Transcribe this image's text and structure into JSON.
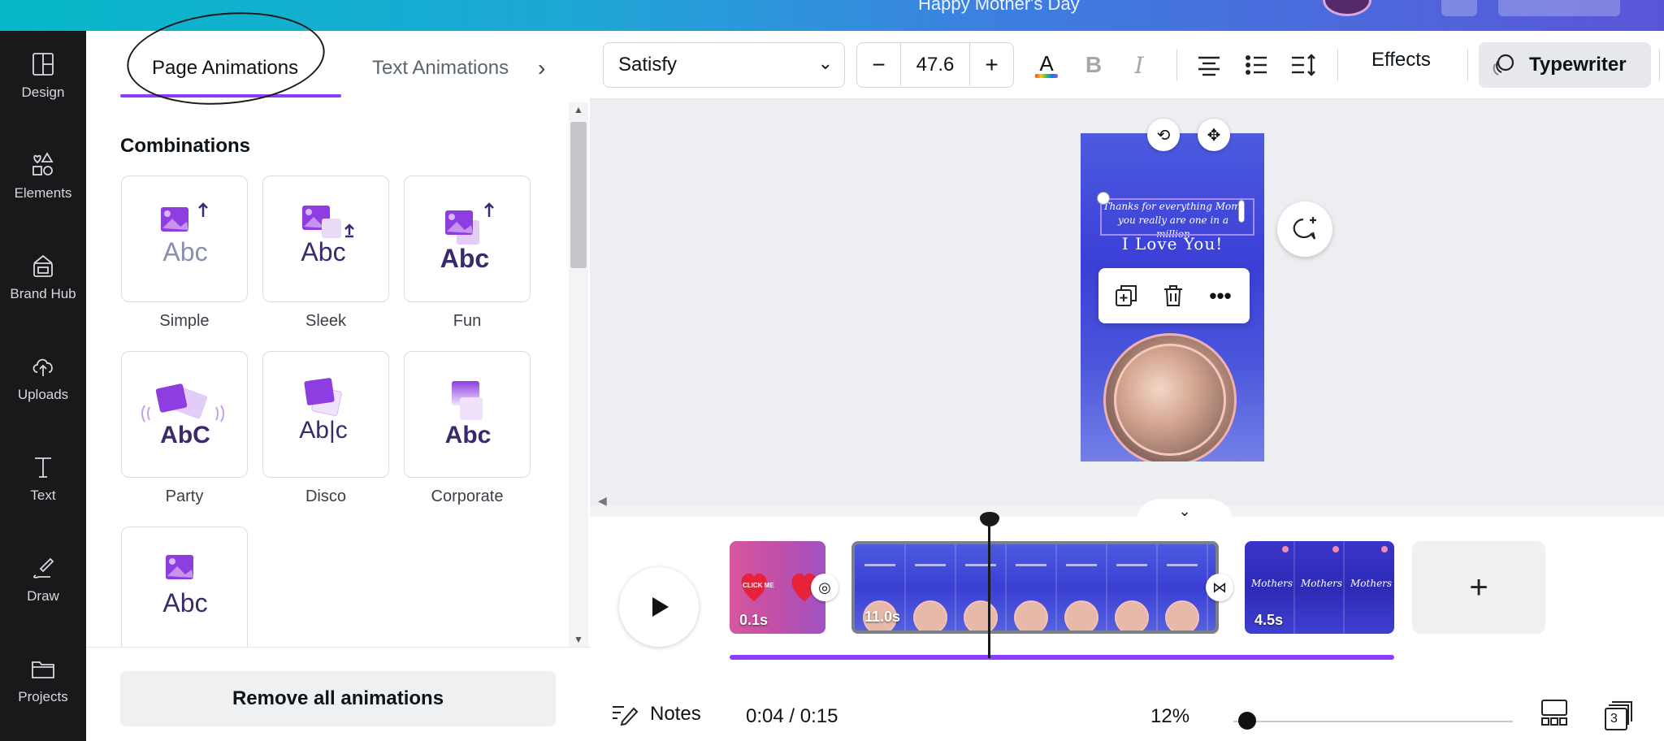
{
  "topbar": {
    "title": "Happy Mother's Day"
  },
  "sidebar": {
    "items": [
      {
        "label": "Design",
        "icon": "layout-icon"
      },
      {
        "label": "Elements",
        "icon": "shapes-icon"
      },
      {
        "label": "Brand Hub",
        "icon": "brand-hub-icon"
      },
      {
        "label": "Uploads",
        "icon": "cloud-upload-icon"
      },
      {
        "label": "Text",
        "icon": "text-icon"
      },
      {
        "label": "Draw",
        "icon": "pen-icon"
      },
      {
        "label": "Projects",
        "icon": "folder-icon"
      }
    ]
  },
  "panel": {
    "tabs": [
      {
        "label": "Page Animations",
        "active": true
      },
      {
        "label": "Text Animations",
        "active": false
      }
    ],
    "section_title": "Combinations",
    "animations": [
      {
        "label": "Simple"
      },
      {
        "label": "Sleek"
      },
      {
        "label": "Fun"
      },
      {
        "label": "Party"
      },
      {
        "label": "Disco"
      },
      {
        "label": "Corporate"
      },
      {
        "label": ""
      }
    ],
    "remove_button": "Remove all animations"
  },
  "toolbar": {
    "font": "Satisfy",
    "font_size": "47.6",
    "minus": "−",
    "plus": "+",
    "effects": "Effects",
    "animation": "Typewriter",
    "colors": {
      "accent": "#8b3dff",
      "text_color_bar": "rainbow"
    }
  },
  "canvas": {
    "line1": "Thanks for everything Mom, you really are one in a million",
    "line2": "I Love You!"
  },
  "timeline": {
    "clips": [
      {
        "duration": "0.1s",
        "frame_label": "CLICK ME"
      },
      {
        "duration": "11.0s"
      },
      {
        "duration": "4.5s",
        "frame_label": "Mothers"
      }
    ],
    "add_label": "+"
  },
  "footer": {
    "notes": "Notes",
    "time": "0:04 / 0:15",
    "zoom": "12%",
    "pages": "3"
  }
}
